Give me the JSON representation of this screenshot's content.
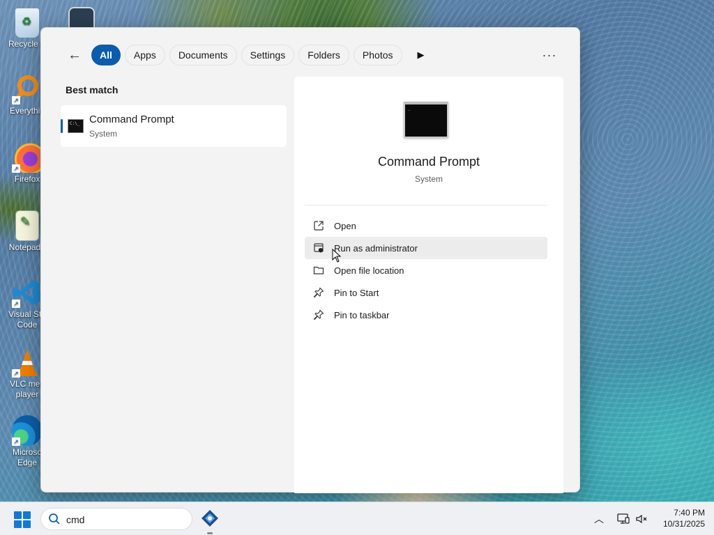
{
  "desktop": {
    "icons": [
      {
        "label": "Recycle B",
        "icon": "recycle-bin-icon"
      },
      {
        "label": "Everythin",
        "icon": "everything-search-icon"
      },
      {
        "label": "Firefox",
        "icon": "firefox-icon"
      },
      {
        "label": "Notepad+",
        "icon": "notepad-plus-plus-icon"
      },
      {
        "label": "Visual Stu",
        "label2": "Code",
        "icon": "vscode-icon"
      },
      {
        "label": "VLC med",
        "label2": "player",
        "icon": "vlc-icon"
      },
      {
        "label": "Microso",
        "label2": "Edge",
        "icon": "edge-icon"
      }
    ]
  },
  "search_panel": {
    "filters": [
      "All",
      "Apps",
      "Documents",
      "Settings",
      "Folders",
      "Photos"
    ],
    "active_filter": "All",
    "more_label": "···",
    "best_match_label": "Best match",
    "result": {
      "name": "Command Prompt",
      "type": "System",
      "icon_text": "C:\\_"
    },
    "preview": {
      "title": "Command Prompt",
      "subtitle": "System",
      "actions": [
        {
          "label": "Open",
          "icon": "open-external-icon"
        },
        {
          "label": "Run as administrator",
          "icon": "shield-admin-icon"
        },
        {
          "label": "Open file location",
          "icon": "folder-icon"
        },
        {
          "label": "Pin to Start",
          "icon": "pin-icon"
        },
        {
          "label": "Pin to taskbar",
          "icon": "pin-icon"
        }
      ],
      "hovered_action_index": 1
    }
  },
  "taskbar": {
    "search_text": "cmd",
    "time": "7:40 PM",
    "date": "10/31/2025"
  },
  "colors": {
    "accent": "#0b5cad",
    "panel_bg": "#f3f3f3",
    "start_blue": "#1677d3"
  }
}
